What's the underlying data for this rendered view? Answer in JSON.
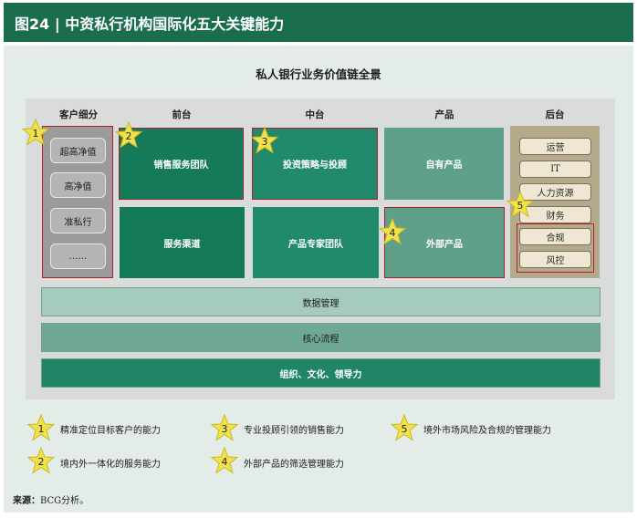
{
  "header": {
    "title": "图24 | 中资私行机构国际化五大关键能力"
  },
  "diagram": {
    "title": "私人银行业务价值链全景",
    "columns": [
      "客户细分",
      "前台",
      "中台",
      "产品",
      "后台"
    ],
    "segments": [
      "超高净值",
      "高净值",
      "准私行",
      "……"
    ],
    "front": [
      "销售服务团队",
      "服务渠道"
    ],
    "middle": [
      "投资策略与投顾",
      "产品专家团队"
    ],
    "product": [
      "自有产品",
      "外部产品"
    ],
    "back": [
      "运营",
      "IT",
      "人力资源",
      "财务",
      "合规",
      "风控"
    ],
    "bars": [
      "数据管理",
      "核心流程",
      "组织、文化、领导力"
    ]
  },
  "stars": [
    "1",
    "2",
    "3",
    "4",
    "5"
  ],
  "legend": [
    {
      "num": "1",
      "text": "精准定位目标客户的能力"
    },
    {
      "num": "2",
      "text": "境内外一体化的服务能力"
    },
    {
      "num": "3",
      "text": "专业投顾引领的销售能力"
    },
    {
      "num": "4",
      "text": "外部产品的筛选管理能力"
    },
    {
      "num": "5",
      "text": "境外市场风险及合规的管理能力"
    }
  ],
  "source": {
    "label": "来源：",
    "text": "BCG分析。"
  },
  "colors": {
    "header": "#1a6e4e",
    "dark_green": "#147a5a",
    "light_green": "#5fa08a",
    "highlight_border": "#b01e2a",
    "star_fill": "#f2e24a"
  }
}
